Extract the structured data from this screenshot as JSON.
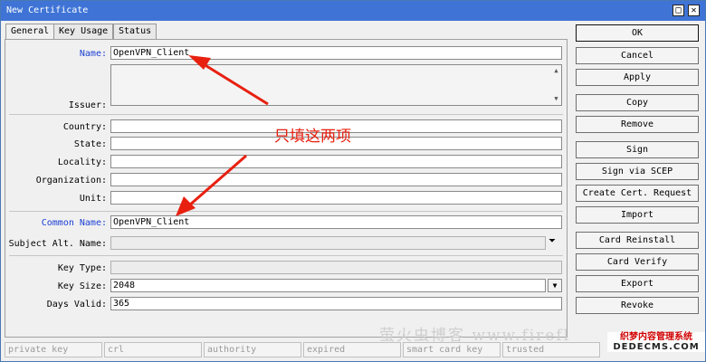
{
  "window": {
    "title": "New Certificate",
    "maximize_glyph": "□",
    "close_glyph": "✕"
  },
  "tabs": [
    {
      "label": "General",
      "active": true
    },
    {
      "label": "Key Usage",
      "active": false
    },
    {
      "label": "Status",
      "active": false
    }
  ],
  "form": {
    "name": {
      "label": "Name:",
      "value": "OpenVPN_Client"
    },
    "issuer": {
      "label": "Issuer:"
    },
    "country": {
      "label": "Country:",
      "value": ""
    },
    "state": {
      "label": "State:",
      "value": ""
    },
    "locality": {
      "label": "Locality:",
      "value": ""
    },
    "organization": {
      "label": "Organization:",
      "value": ""
    },
    "unit": {
      "label": "Unit:",
      "value": ""
    },
    "common_name": {
      "label": "Common Name:",
      "value": "OpenVPN_Client"
    },
    "subject_alt_name": {
      "label": "Subject Alt. Name:",
      "value": ""
    },
    "key_type": {
      "label": "Key Type:",
      "value": ""
    },
    "key_size": {
      "label": "Key Size:",
      "value": "2048"
    },
    "days_valid": {
      "label": "Days Valid:",
      "value": "365"
    }
  },
  "buttons": {
    "ok": "OK",
    "cancel": "Cancel",
    "apply": "Apply",
    "copy": "Copy",
    "remove": "Remove",
    "sign": "Sign",
    "sign_via_scep": "Sign via SCEP",
    "create_cert_request": "Create Cert. Request",
    "import": "Import",
    "card_reinstall": "Card Reinstall",
    "card_verify": "Card Verify",
    "export": "Export",
    "revoke": "Revoke"
  },
  "status": [
    "private key",
    "crl",
    "authority",
    "expired",
    "smart card key",
    "trusted"
  ],
  "annotation": {
    "text": "只填这两项",
    "color": "#e82010"
  },
  "watermark": {
    "blog": "萤火虫博客 www.firefl",
    "cms_line1": "织梦内容管理系统",
    "cms_line2": "DEDECMS.COM"
  },
  "colors": {
    "titlebar": "#3f74d6",
    "label_blue": "#1c3fd4"
  },
  "icons": {
    "dropdown": "dropdown-arrow-icon",
    "scroll": "scroll-arrow-icon"
  }
}
